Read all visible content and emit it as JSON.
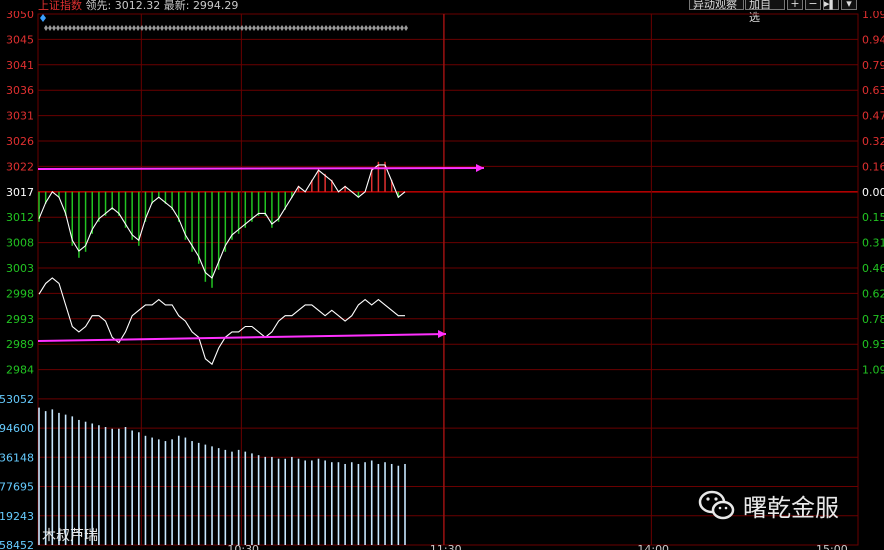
{
  "header": {
    "index_name": "上证指数",
    "lead_label": "领先:",
    "lead_value": "3012.32",
    "latest_label": "最新:",
    "latest_value": "2994.29",
    "btn_monitor": "异动观察",
    "btn_add": "加自选",
    "icon_plus": "+",
    "icon_minus": "−",
    "icon_expand": "▸▍",
    "icon_dropdown": "▾"
  },
  "colors": {
    "up": "#e03030",
    "down": "#22c422",
    "flat": "#ffffff",
    "grid": "#6a0000",
    "arrow": "#ff30ff",
    "volume": "#c8e8ff"
  },
  "chart_data": {
    "type": "line",
    "price_axis_left": [
      "3050",
      "3045",
      "3041",
      "3036",
      "3031",
      "3026",
      "3022",
      "3017",
      "3012",
      "3008",
      "3003",
      "2998",
      "2993",
      "2989",
      "2984"
    ],
    "percent_axis_right": [
      "1.09",
      "0.94",
      "0.79",
      "0.63",
      "0.47",
      "0.32",
      "0.16",
      "0.00",
      "0.15",
      "0.31",
      "0.46",
      "0.62",
      "0.78",
      "0.93",
      "1.09"
    ],
    "volume_axis_left": [
      "53052",
      "94600",
      "36148",
      "77695",
      "19243",
      "58452"
    ],
    "time_axis": [
      "10:30",
      "11:30",
      "14:00",
      "15:00"
    ],
    "ylim": [
      2984,
      3050
    ],
    "base_price": 3017,
    "series": [
      {
        "name": "",
        "values": [
          2998,
          3000,
          3001,
          3000,
          2996,
          2992,
          2991,
          2992,
          2994,
          2994,
          2993,
          2990,
          2989,
          2991,
          2994,
          2995,
          2996,
          2996,
          2997,
          2996,
          2996,
          2994,
          2993,
          2991,
          2990,
          2986,
          2985,
          2988,
          2990,
          2991,
          2991,
          2992,
          2992,
          2991,
          2990,
          2991,
          2993,
          2994,
          2994,
          2995,
          2996,
          2996,
          2995,
          2994,
          2995,
          2994,
          2993,
          2994,
          2996,
          2997,
          2996,
          2997,
          2996,
          2995,
          2994,
          2994
        ]
      },
      {
        "name": "",
        "values": [
          3012,
          3015,
          3017,
          3016,
          3013,
          3008,
          3006,
          3007,
          3010,
          3012,
          3013,
          3014,
          3013,
          3011,
          3009,
          3008,
          3012,
          3015,
          3016,
          3015,
          3014,
          3012,
          3009,
          3007,
          3005,
          3002,
          3001,
          3004,
          3007,
          3009,
          3010,
          3011,
          3012,
          3013,
          3013,
          3011,
          3012,
          3014,
          3016,
          3018,
          3017,
          3019,
          3021,
          3020,
          3019,
          3017,
          3018,
          3017,
          3016,
          3017,
          3021,
          3022,
          3022,
          3019,
          3016,
          3017
        ]
      }
    ],
    "volume_values": [
      78000,
      76000,
      77000,
      75000,
      74000,
      73000,
      71000,
      70000,
      69000,
      68000,
      67000,
      66000,
      66000,
      67000,
      65000,
      64000,
      62000,
      61000,
      60000,
      59000,
      60000,
      62000,
      61000,
      59000,
      58000,
      57000,
      56000,
      55000,
      54000,
      53000,
      54000,
      53000,
      52000,
      51000,
      50000,
      50000,
      49000,
      49000,
      50000,
      49000,
      48000,
      48000,
      49000,
      48000,
      47000,
      47000,
      46000,
      47000,
      46000,
      47000,
      48000,
      46000,
      47000,
      46000,
      45000,
      46000
    ]
  },
  "watermark_brand": "曙乾金服",
  "bottom_overlay": "木叔芦瑞"
}
